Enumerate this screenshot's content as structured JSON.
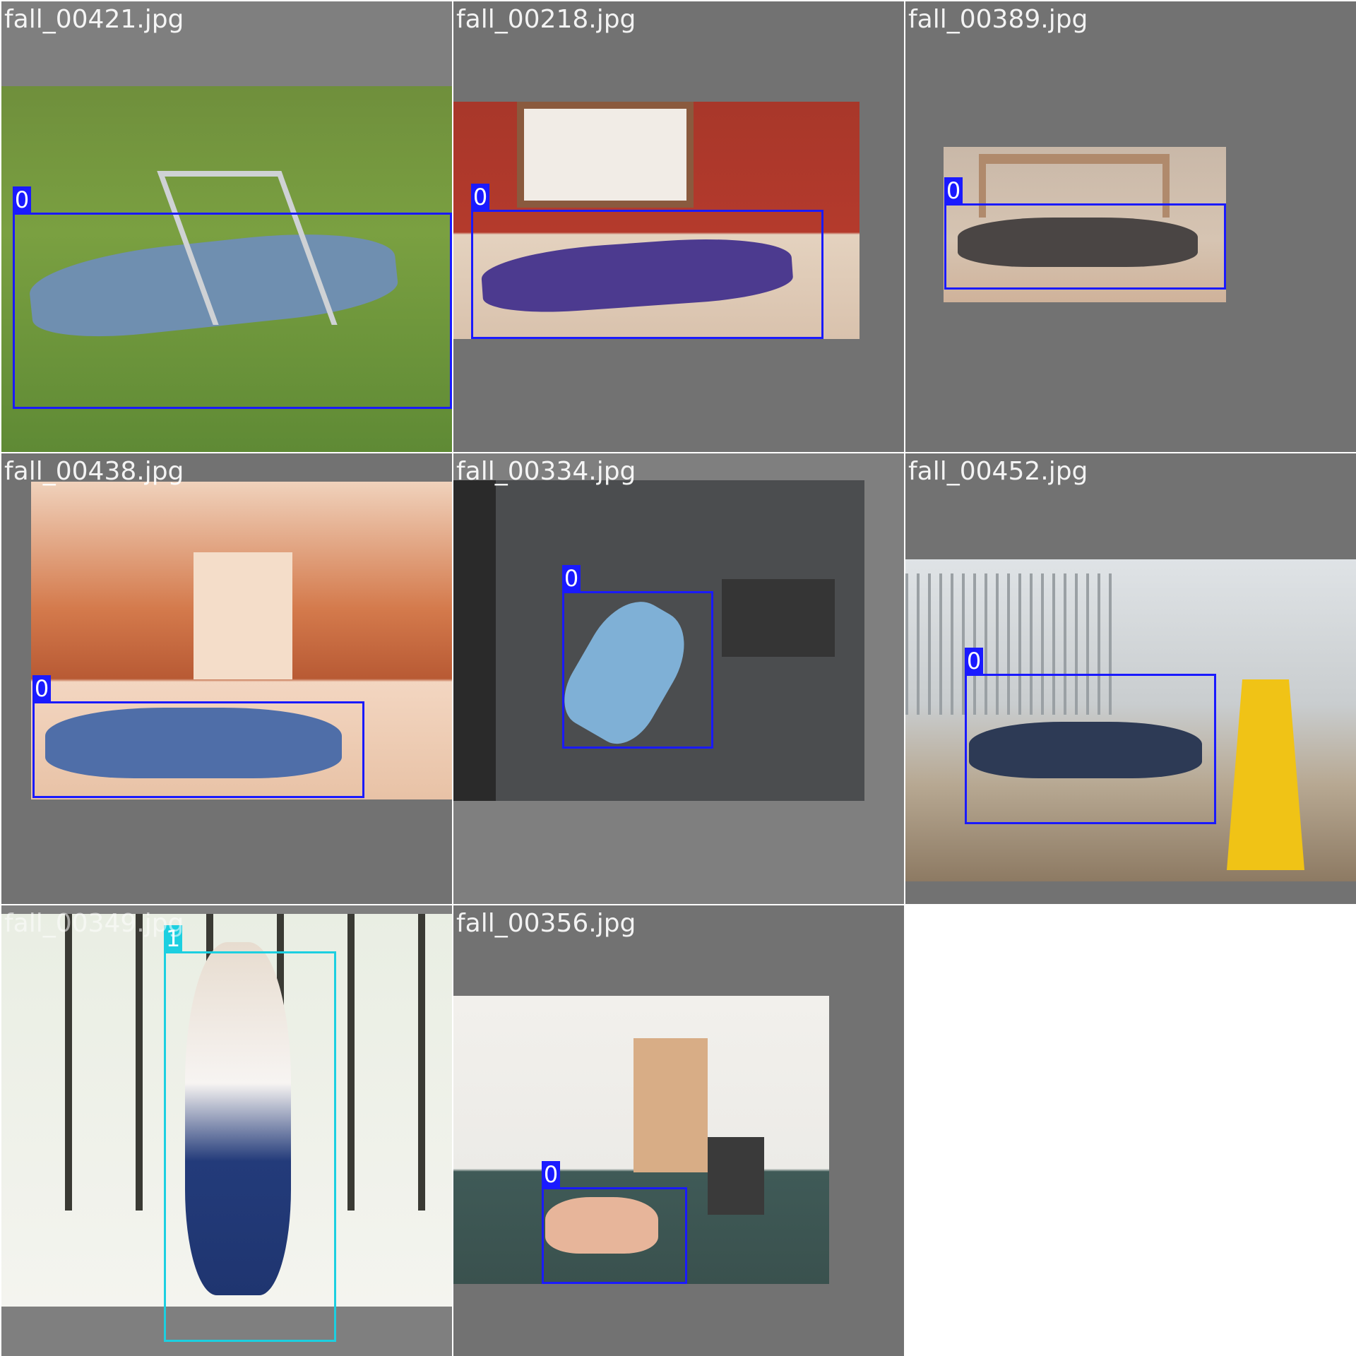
{
  "tiles": [
    {
      "filename": "fall_00421.jpg",
      "label": "0"
    },
    {
      "filename": "fall_00218.jpg",
      "label": "0"
    },
    {
      "filename": "fall_00389.jpg",
      "label": "0"
    },
    {
      "filename": "fall_00438.jpg",
      "label": "0"
    },
    {
      "filename": "fall_00334.jpg",
      "label": "0"
    },
    {
      "filename": "fall_00452.jpg",
      "label": "0"
    },
    {
      "filename": "fall_00349.jpg",
      "label": "1"
    },
    {
      "filename": "fall_00356.jpg",
      "label": "0"
    }
  ],
  "class_colors": {
    "0": "#1a1aff",
    "1": "#1ccfe0"
  },
  "background_colors": {
    "padding_dark": "#727272",
    "padding_light": "#7f7f7f",
    "empty": "#ffffff"
  }
}
